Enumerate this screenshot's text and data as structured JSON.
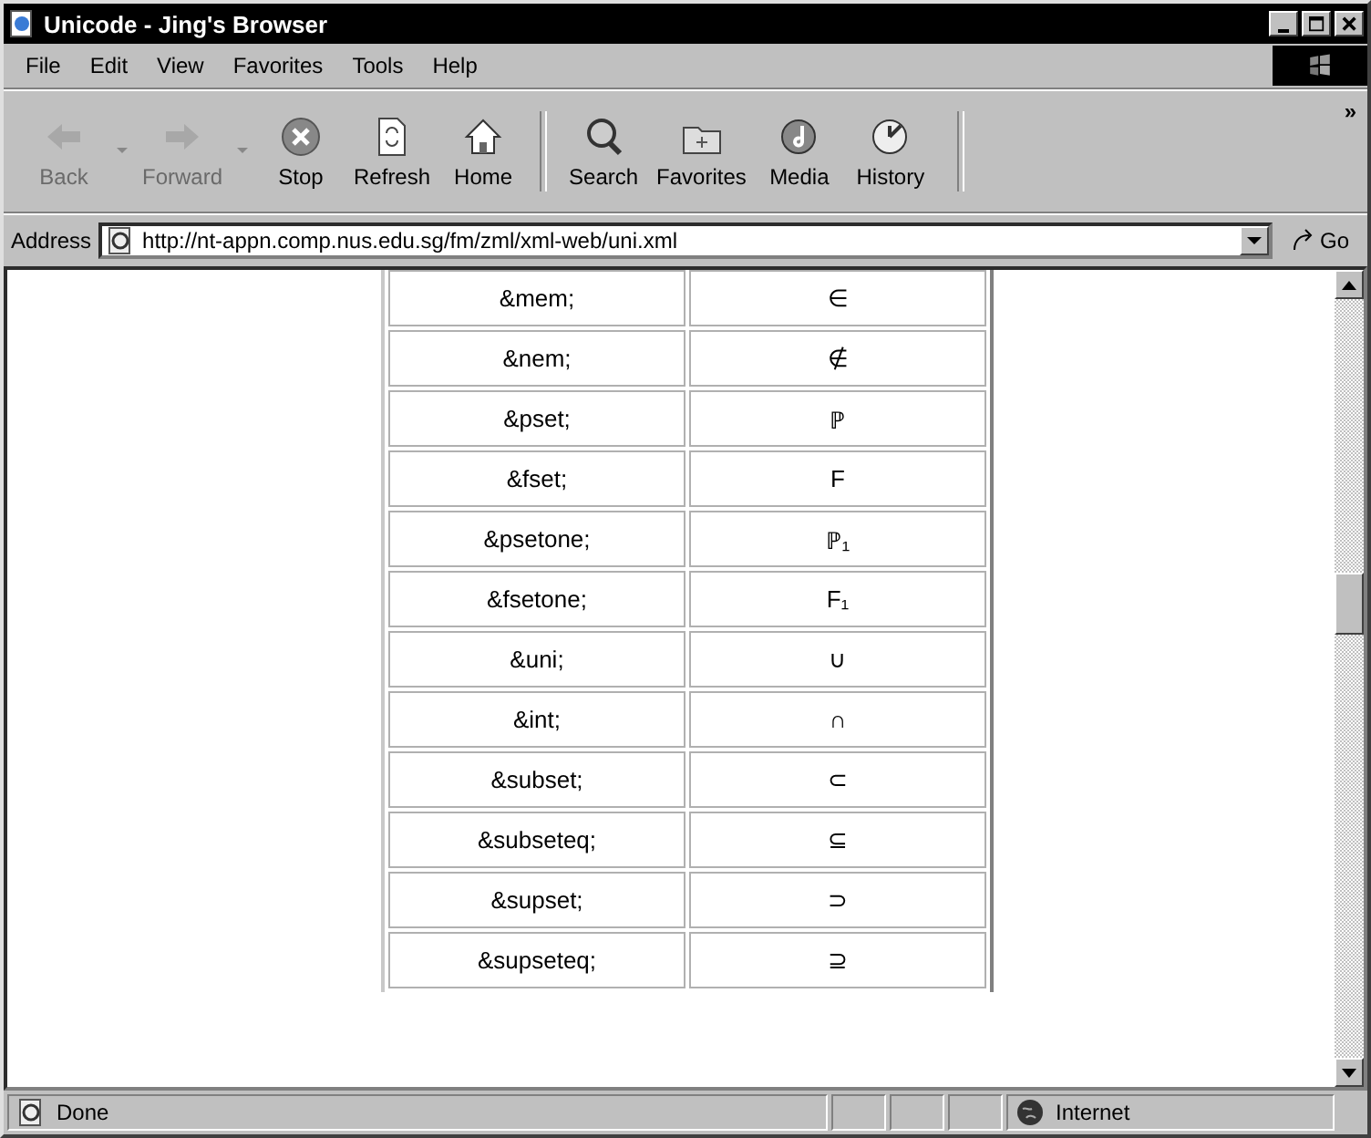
{
  "window": {
    "title": "Unicode - Jing's Browser"
  },
  "menu": [
    {
      "label": "File"
    },
    {
      "label": "Edit"
    },
    {
      "label": "View"
    },
    {
      "label": "Favorites"
    },
    {
      "label": "Tools"
    },
    {
      "label": "Help"
    }
  ],
  "toolbar": [
    {
      "label": "Back",
      "kind": "back",
      "disabled": true,
      "dropdown": true
    },
    {
      "label": "Forward",
      "kind": "forward",
      "disabled": true,
      "dropdown": true
    },
    {
      "label": "Stop",
      "kind": "stop",
      "disabled": false,
      "dropdown": false
    },
    {
      "label": "Refresh",
      "kind": "refresh",
      "disabled": false,
      "dropdown": false
    },
    {
      "label": "Home",
      "kind": "home",
      "disabled": false,
      "dropdown": false
    },
    {
      "label": "Search",
      "kind": "search",
      "disabled": false,
      "dropdown": false
    },
    {
      "label": "Favorites",
      "kind": "favorites",
      "disabled": false,
      "dropdown": false
    },
    {
      "label": "Media",
      "kind": "media",
      "disabled": false,
      "dropdown": false
    },
    {
      "label": "History",
      "kind": "history",
      "disabled": false,
      "dropdown": false
    }
  ],
  "toolbar_more": "»",
  "address": {
    "label": "Address",
    "value": "http://nt-appn.comp.nus.edu.sg/fm/zml/xml-web/uni.xml",
    "go": "Go"
  },
  "table": {
    "rows": [
      {
        "entity": "&mem;",
        "glyph": "∈"
      },
      {
        "entity": "&nem;",
        "glyph": "∉"
      },
      {
        "entity": "&pset;",
        "glyph": "ℙ"
      },
      {
        "entity": "&fset;",
        "glyph": "F"
      },
      {
        "entity": "&psetone;",
        "glyph": "ℙ₁"
      },
      {
        "entity": "&fsetone;",
        "glyph": "F₁"
      },
      {
        "entity": "&uni;",
        "glyph": "∪"
      },
      {
        "entity": "&int;",
        "glyph": "∩"
      },
      {
        "entity": "&subset;",
        "glyph": "⊂"
      },
      {
        "entity": "&subseteq;",
        "glyph": "⊆"
      },
      {
        "entity": "&supset;",
        "glyph": "⊃"
      },
      {
        "entity": "&supseteq;",
        "glyph": "⊇"
      }
    ]
  },
  "status_bar": {
    "text": "Done",
    "zone": "Internet"
  }
}
